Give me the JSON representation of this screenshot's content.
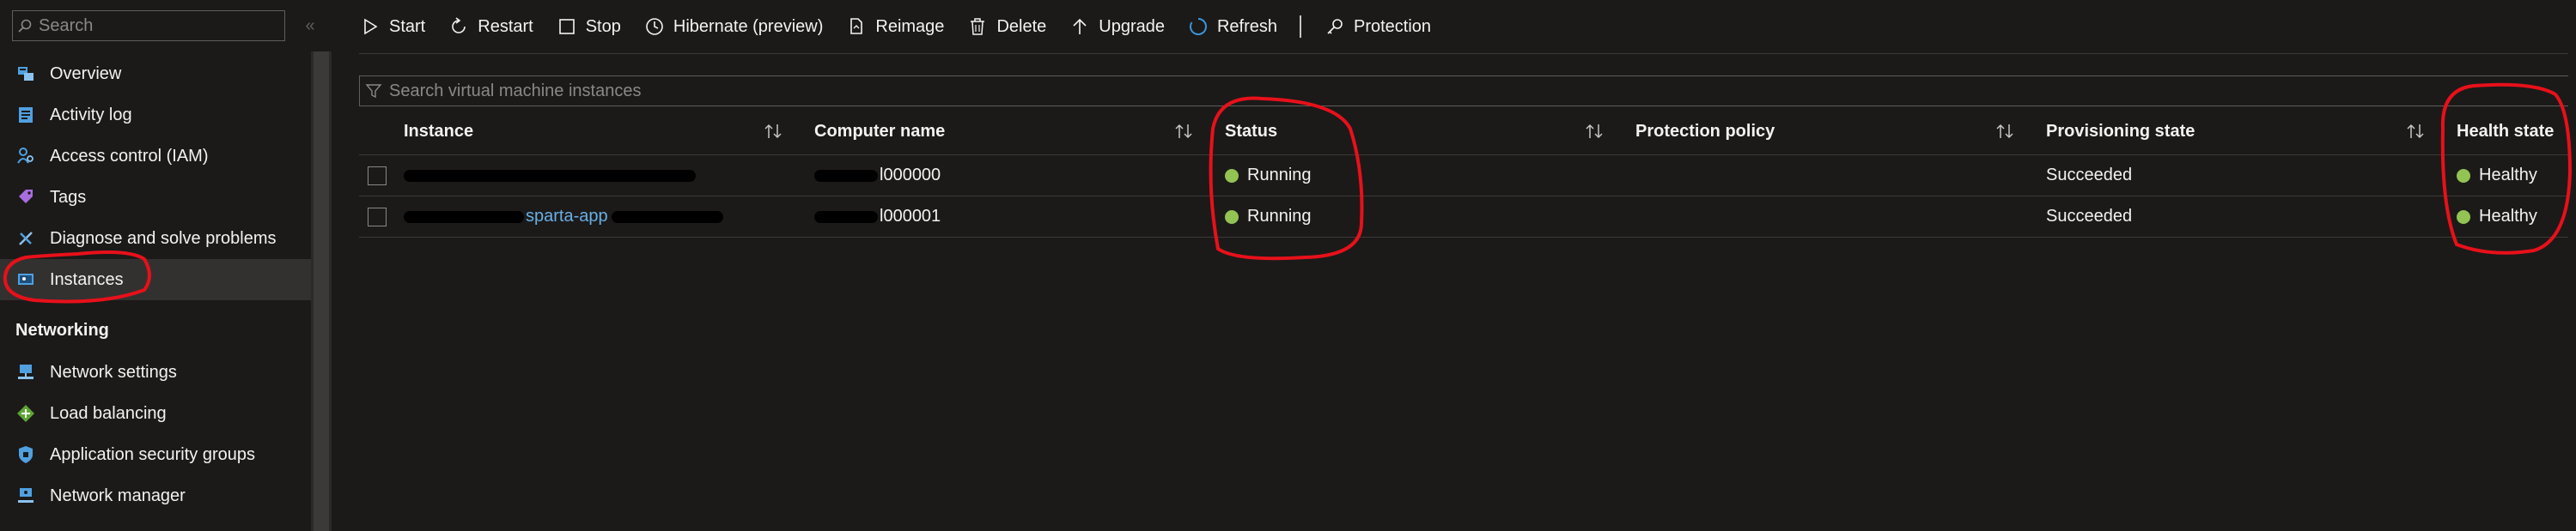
{
  "sidebar": {
    "search_placeholder": "Search",
    "collapse_glyph": "«",
    "items": [
      {
        "label": "Overview",
        "icon": "overview-icon"
      },
      {
        "label": "Activity log",
        "icon": "activity-log-icon"
      },
      {
        "label": "Access control (IAM)",
        "icon": "access-control-icon"
      },
      {
        "label": "Tags",
        "icon": "tag-icon"
      },
      {
        "label": "Diagnose and solve problems",
        "icon": "wrench-icon"
      },
      {
        "label": "Instances",
        "icon": "instances-icon",
        "selected": true
      }
    ],
    "networking_title": "Networking",
    "networking_items": [
      {
        "label": "Network settings",
        "icon": "network-settings-icon"
      },
      {
        "label": "Load balancing",
        "icon": "load-balancing-icon"
      },
      {
        "label": "Application security groups",
        "icon": "shield-icon"
      },
      {
        "label": "Network manager",
        "icon": "network-manager-icon"
      }
    ]
  },
  "toolbar": {
    "start": "Start",
    "restart": "Restart",
    "stop": "Stop",
    "hibernate": "Hibernate (preview)",
    "reimage": "Reimage",
    "delete": "Delete",
    "upgrade": "Upgrade",
    "refresh": "Refresh",
    "protection": "Protection"
  },
  "filter": {
    "placeholder": "Search virtual machine instances"
  },
  "table": {
    "columns": [
      "Instance",
      "Computer name",
      "Status",
      "Protection policy",
      "Provisioning state",
      "Health state"
    ],
    "rows": [
      {
        "instance": "",
        "computer_name": "l000000",
        "status": "Running",
        "protection_policy": "",
        "provisioning_state": "Succeeded",
        "health_state": "Healthy"
      },
      {
        "instance": "sparta-app",
        "computer_name": "l000001",
        "status": "Running",
        "protection_policy": "",
        "provisioning_state": "Succeeded",
        "health_state": "Healthy"
      }
    ]
  },
  "colors": {
    "background": "#1b1a19",
    "link": "#69afe5",
    "status_ok": "#92c353",
    "annotation": "#e8101a",
    "refresh_accent": "#3a96dd"
  }
}
